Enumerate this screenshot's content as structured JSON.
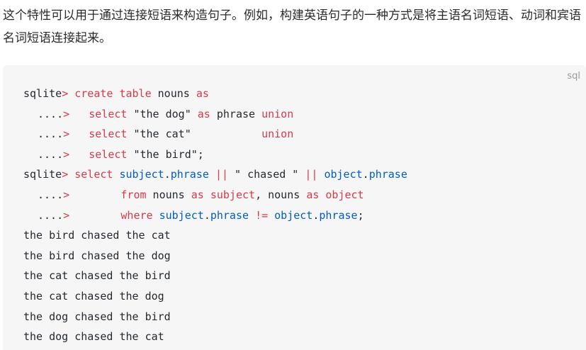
{
  "intro": {
    "text": "这个特性可以用于通过连接短语来构造句子。例如，构建英语句子的一种方式是将主语名词短语、动词和宾语名词短语连接起来。"
  },
  "code_block": {
    "language": "sql",
    "lines": [
      {
        "prompt": "sqlite",
        "arrow": ">",
        "tokens": [
          " ",
          "create",
          " ",
          "table",
          " nouns ",
          "as"
        ]
      },
      {
        "prompt": "....",
        "arrow": ">",
        "tokens": [
          "   ",
          "select",
          " \"the dog\" ",
          "as",
          " phrase ",
          "union"
        ]
      },
      {
        "prompt": "....",
        "arrow": ">",
        "tokens": [
          "   ",
          "select",
          " \"the cat\"           ",
          "union"
        ]
      },
      {
        "prompt": "....",
        "arrow": ">",
        "tokens": [
          "   ",
          "select",
          " \"the bird\";"
        ]
      },
      {
        "prompt": "sqlite",
        "arrow": ">",
        "tokens": [
          " ",
          "select",
          " ",
          "subject",
          ".",
          "phrase",
          " ",
          "||",
          " \" chased \" ",
          "||",
          " ",
          "object",
          ".",
          "phrase"
        ]
      },
      {
        "prompt": "....",
        "arrow": ">",
        "tokens": [
          "        ",
          "from",
          " nouns ",
          "as",
          " ",
          "subject",
          ", nouns ",
          "as",
          " ",
          "object"
        ]
      },
      {
        "prompt": "....",
        "arrow": ">",
        "tokens": [
          "        ",
          "where",
          " ",
          "subject",
          ".",
          "phrase",
          " ",
          "!=",
          " ",
          "object",
          ".",
          "phrase",
          ";"
        ]
      }
    ],
    "output": [
      "the bird chased the cat",
      "the bird chased the dog",
      "the cat chased the bird",
      "the cat chased the dog",
      "the dog chased the bird",
      "the dog chased the cat"
    ]
  }
}
